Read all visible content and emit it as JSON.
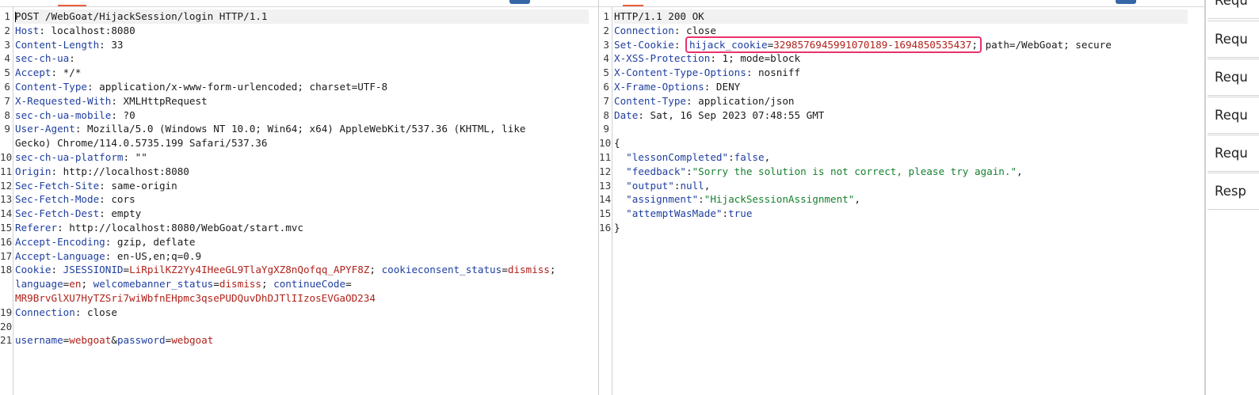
{
  "request": {
    "lines": [
      {
        "n": "1",
        "segs": [
          {
            "t": "POST /WebGoat/HijackSession/login HTTP/1.1",
            "c": "p"
          }
        ]
      },
      {
        "n": "2",
        "segs": [
          {
            "t": "Host",
            "c": "hn"
          },
          {
            "t": ": localhost:8080",
            "c": "v"
          }
        ]
      },
      {
        "n": "3",
        "segs": [
          {
            "t": "Content-Length",
            "c": "hn"
          },
          {
            "t": ": 33",
            "c": "v"
          }
        ]
      },
      {
        "n": "4",
        "segs": [
          {
            "t": "sec-ch-ua",
            "c": "hn"
          },
          {
            "t": ":",
            "c": "v"
          }
        ]
      },
      {
        "n": "5",
        "segs": [
          {
            "t": "Accept",
            "c": "hn"
          },
          {
            "t": ": */*",
            "c": "v"
          }
        ]
      },
      {
        "n": "6",
        "segs": [
          {
            "t": "Content-Type",
            "c": "hn"
          },
          {
            "t": ": application/x-www-form-urlencoded; charset=UTF-8",
            "c": "v"
          }
        ]
      },
      {
        "n": "7",
        "segs": [
          {
            "t": "X-Requested-With",
            "c": "hn"
          },
          {
            "t": ": XMLHttpRequest",
            "c": "v"
          }
        ]
      },
      {
        "n": "8",
        "segs": [
          {
            "t": "sec-ch-ua-mobile",
            "c": "hn"
          },
          {
            "t": ": ?0",
            "c": "v"
          }
        ]
      },
      {
        "n": "9",
        "segs": [
          {
            "t": "User-Agent",
            "c": "hn"
          },
          {
            "t": ": Mozilla/5.0 (Windows NT 10.0; Win64; x64) AppleWebKit/537.36 (KHTML, like",
            "c": "v"
          }
        ]
      },
      {
        "n": "",
        "segs": [
          {
            "t": "Gecko) Chrome/114.0.5735.199 Safari/537.36",
            "c": "v"
          }
        ]
      },
      {
        "n": "10",
        "segs": [
          {
            "t": "sec-ch-ua-platform",
            "c": "hn"
          },
          {
            "t": ": \"\"",
            "c": "v"
          }
        ]
      },
      {
        "n": "11",
        "segs": [
          {
            "t": "Origin",
            "c": "hn"
          },
          {
            "t": ": http://localhost:8080",
            "c": "v"
          }
        ]
      },
      {
        "n": "12",
        "segs": [
          {
            "t": "Sec-Fetch-Site",
            "c": "hn"
          },
          {
            "t": ": same-origin",
            "c": "v"
          }
        ]
      },
      {
        "n": "13",
        "segs": [
          {
            "t": "Sec-Fetch-Mode",
            "c": "hn"
          },
          {
            "t": ": cors",
            "c": "v"
          }
        ]
      },
      {
        "n": "14",
        "segs": [
          {
            "t": "Sec-Fetch-Dest",
            "c": "hn"
          },
          {
            "t": ": empty",
            "c": "v"
          }
        ]
      },
      {
        "n": "15",
        "segs": [
          {
            "t": "Referer",
            "c": "hn"
          },
          {
            "t": ": http://localhost:8080/WebGoat/start.mvc",
            "c": "v"
          }
        ]
      },
      {
        "n": "16",
        "segs": [
          {
            "t": "Accept-Encoding",
            "c": "hn"
          },
          {
            "t": ": gzip, deflate",
            "c": "v"
          }
        ]
      },
      {
        "n": "17",
        "segs": [
          {
            "t": "Accept-Language",
            "c": "hn"
          },
          {
            "t": ": en-US,en;q=0.9",
            "c": "v"
          }
        ]
      },
      {
        "n": "18",
        "segs": [
          {
            "t": "Cookie",
            "c": "hn"
          },
          {
            "t": ": ",
            "c": "v"
          },
          {
            "t": "JSESSIONID",
            "c": "ck"
          },
          {
            "t": "=",
            "c": "v"
          },
          {
            "t": "LiRpilKZ2Yy4IHeeGL9TlaYgXZ8nQofqq_APYF8Z",
            "c": "cv"
          },
          {
            "t": "; ",
            "c": "v"
          },
          {
            "t": "cookieconsent_status",
            "c": "ck"
          },
          {
            "t": "=",
            "c": "v"
          },
          {
            "t": "dismiss",
            "c": "cv"
          },
          {
            "t": ";",
            "c": "v"
          }
        ]
      },
      {
        "n": "",
        "segs": [
          {
            "t": "language",
            "c": "ck"
          },
          {
            "t": "=",
            "c": "v"
          },
          {
            "t": "en",
            "c": "cv"
          },
          {
            "t": "; ",
            "c": "v"
          },
          {
            "t": "welcomebanner_status",
            "c": "ck"
          },
          {
            "t": "=",
            "c": "v"
          },
          {
            "t": "dismiss",
            "c": "cv"
          },
          {
            "t": "; ",
            "c": "v"
          },
          {
            "t": "continueCode",
            "c": "ck"
          },
          {
            "t": "=",
            "c": "v"
          }
        ]
      },
      {
        "n": "",
        "segs": [
          {
            "t": "MR9BrvGlXU7HyTZSri7wiWbfnEHpmc3qsePUDQuvDhDJTlIIzosEVGaOD234",
            "c": "cv"
          }
        ]
      },
      {
        "n": "19",
        "segs": [
          {
            "t": "Connection",
            "c": "hn"
          },
          {
            "t": ": close",
            "c": "v"
          }
        ]
      },
      {
        "n": "20",
        "segs": []
      },
      {
        "n": "21",
        "segs": [
          {
            "t": "username",
            "c": "ck"
          },
          {
            "t": "=",
            "c": "v"
          },
          {
            "t": "webgoat",
            "c": "cv"
          },
          {
            "t": "&",
            "c": "v"
          },
          {
            "t": "password",
            "c": "ck"
          },
          {
            "t": "=",
            "c": "v"
          },
          {
            "t": "webgoat",
            "c": "cv"
          }
        ]
      }
    ]
  },
  "response": {
    "lines": [
      {
        "n": "1",
        "segs": [
          {
            "t": "HTTP/1.1 200 OK",
            "c": "p"
          }
        ]
      },
      {
        "n": "2",
        "segs": [
          {
            "t": "Connection",
            "c": "hn"
          },
          {
            "t": ": close",
            "c": "v"
          }
        ]
      },
      {
        "n": "3",
        "segs": [
          {
            "t": "Set-Cookie",
            "c": "hn"
          },
          {
            "t": ": ",
            "c": "v"
          },
          {
            "t": "hijack_cookie",
            "c": "ck",
            "hl": true
          },
          {
            "t": "=",
            "c": "v",
            "hl": true
          },
          {
            "t": "3298576945991070189-1694850535437",
            "c": "cv",
            "hl": true
          },
          {
            "t": ";",
            "c": "v",
            "hl": true
          },
          {
            "t": " path=/WebGoat; secure",
            "c": "v"
          }
        ]
      },
      {
        "n": "4",
        "segs": [
          {
            "t": "X-XSS-Protection",
            "c": "hn"
          },
          {
            "t": ": 1; mode=block",
            "c": "v"
          }
        ]
      },
      {
        "n": "5",
        "segs": [
          {
            "t": "X-Content-Type-Options",
            "c": "hn"
          },
          {
            "t": ": nosniff",
            "c": "v"
          }
        ]
      },
      {
        "n": "6",
        "segs": [
          {
            "t": "X-Frame-Options",
            "c": "hn"
          },
          {
            "t": ": DENY",
            "c": "v"
          }
        ]
      },
      {
        "n": "7",
        "segs": [
          {
            "t": "Content-Type",
            "c": "hn"
          },
          {
            "t": ": application/json",
            "c": "v"
          }
        ]
      },
      {
        "n": "8",
        "segs": [
          {
            "t": "Date",
            "c": "hn"
          },
          {
            "t": ": Sat, 16 Sep 2023 07:48:55 GMT",
            "c": "v"
          }
        ]
      },
      {
        "n": "9",
        "segs": []
      },
      {
        "n": "10",
        "segs": [
          {
            "t": "{",
            "c": "v"
          }
        ]
      },
      {
        "n": "11",
        "segs": [
          {
            "t": "  ",
            "c": "v"
          },
          {
            "t": "\"lessonCompleted\"",
            "c": "jk"
          },
          {
            "t": ":",
            "c": "v"
          },
          {
            "t": "false",
            "c": "jb"
          },
          {
            "t": ",",
            "c": "v"
          }
        ]
      },
      {
        "n": "12",
        "segs": [
          {
            "t": "  ",
            "c": "v"
          },
          {
            "t": "\"feedback\"",
            "c": "jk"
          },
          {
            "t": ":",
            "c": "v"
          },
          {
            "t": "\"Sorry the solution is not correct, please try again.\"",
            "c": "js"
          },
          {
            "t": ",",
            "c": "v"
          }
        ]
      },
      {
        "n": "13",
        "segs": [
          {
            "t": "  ",
            "c": "v"
          },
          {
            "t": "\"output\"",
            "c": "jk"
          },
          {
            "t": ":",
            "c": "v"
          },
          {
            "t": "null",
            "c": "jb"
          },
          {
            "t": ",",
            "c": "v"
          }
        ]
      },
      {
        "n": "14",
        "segs": [
          {
            "t": "  ",
            "c": "v"
          },
          {
            "t": "\"assignment\"",
            "c": "jk"
          },
          {
            "t": ":",
            "c": "v"
          },
          {
            "t": "\"HijackSessionAssignment\"",
            "c": "js"
          },
          {
            "t": ",",
            "c": "v"
          }
        ]
      },
      {
        "n": "15",
        "segs": [
          {
            "t": "  ",
            "c": "v"
          },
          {
            "t": "\"attemptWasMade\"",
            "c": "jk"
          },
          {
            "t": ":",
            "c": "v"
          },
          {
            "t": "true",
            "c": "jb"
          }
        ]
      },
      {
        "n": "16",
        "segs": [
          {
            "t": "}",
            "c": "v"
          }
        ]
      }
    ]
  },
  "side_panel": {
    "items": [
      "Requ",
      "Requ",
      "Requ",
      "Requ",
      "Requ",
      "Resp"
    ]
  },
  "colors": {
    "header_name": "#1f3fa0",
    "cookie_value": "#b0221b",
    "json_string": "#16812f",
    "highlight_box": "#e8336b",
    "active_tab": "#e8603b"
  }
}
